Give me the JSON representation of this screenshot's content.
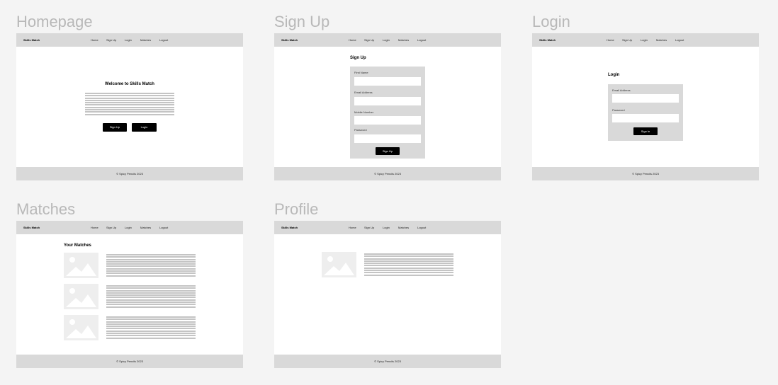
{
  "nav": {
    "brand": "Skills Match",
    "links": [
      "Home",
      "Sign Up",
      "Login",
      "Matches",
      "Logout"
    ]
  },
  "footer": "© Spicy Pencils 2023",
  "frames": {
    "homepage": {
      "title": "Homepage",
      "heading": "Welcome to Skills Match",
      "signup_button": "Sign Up",
      "login_button": "Login"
    },
    "signup": {
      "title": "Sign Up",
      "heading": "Sign Up",
      "fields": [
        "First Name",
        "Email Address",
        "Mobile Number",
        "Password"
      ],
      "submit": "Sign Up"
    },
    "login": {
      "title": "Login",
      "heading": "Login",
      "fields": [
        "Email Address",
        "Password"
      ],
      "submit": "Sign In"
    },
    "matches": {
      "title": "Matches",
      "heading": "Your Matches"
    },
    "profile": {
      "title": "Profile"
    }
  },
  "colors": {
    "page_bg": "#f4f4f4",
    "nav_bg": "#d9d9d9",
    "placeholder_lines": "#c4c4c4",
    "button_bg": "#000000"
  }
}
